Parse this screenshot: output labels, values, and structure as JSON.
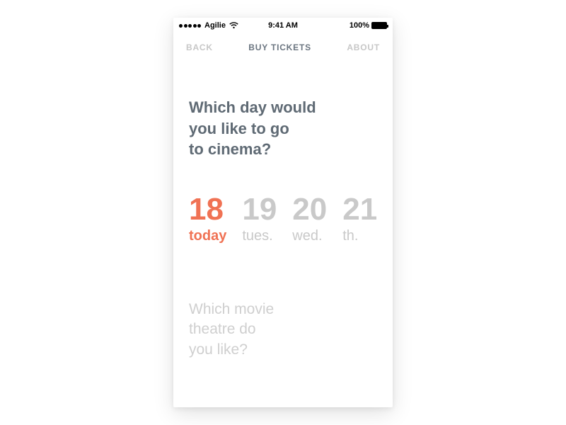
{
  "status": {
    "carrier": "Agilie",
    "time": "9:41 AM",
    "battery": "100%"
  },
  "nav": {
    "back": "BACK",
    "title": "BUY TICKETS",
    "about": "ABOUT"
  },
  "question1": {
    "line1": "Which day would",
    "line2": "you like to go",
    "line3": "to cinema?"
  },
  "days": [
    {
      "num": "18",
      "label": "today",
      "selected": true
    },
    {
      "num": "19",
      "label": "tues.",
      "selected": false
    },
    {
      "num": "20",
      "label": "wed.",
      "selected": false
    },
    {
      "num": "21",
      "label": "th.",
      "selected": false
    }
  ],
  "question2": {
    "line1": "Which movie",
    "line2": "theatre do",
    "line3": "you like?"
  },
  "colors": {
    "accent": "#f07254",
    "heading": "#5f6a74",
    "muted": "#c9c9c9"
  }
}
